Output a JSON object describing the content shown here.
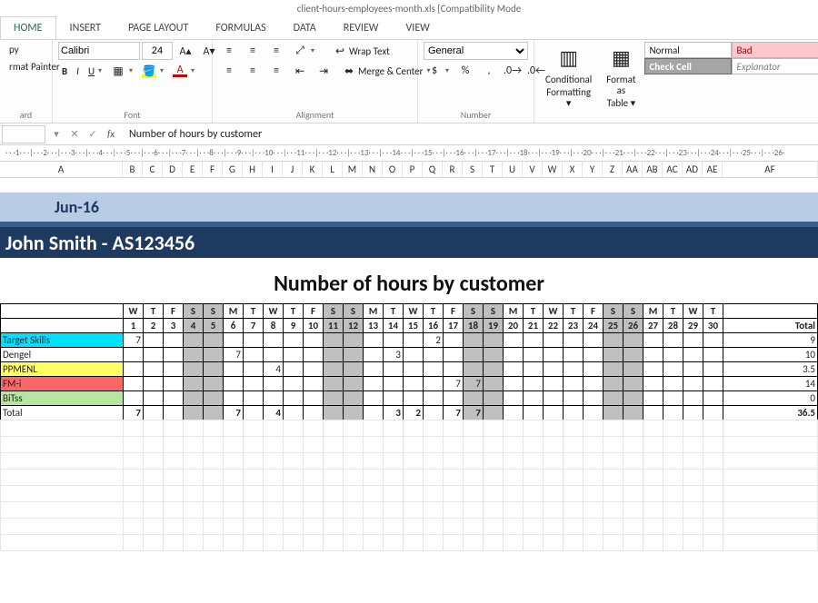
{
  "window": {
    "title": "client-hours-employees-month.xls  [Compatibility Mode"
  },
  "tabs": [
    "HOME",
    "INSERT",
    "PAGE LAYOUT",
    "FORMULAS",
    "DATA",
    "REVIEW",
    "VIEW"
  ],
  "tabs_active": 0,
  "clipboard": {
    "copy": "py",
    "format_painter": "rmat Painter",
    "group": "ard"
  },
  "font": {
    "name": "Calibri",
    "size": "24",
    "bold": "B",
    "italic": "I",
    "underline": "U",
    "group": "Font"
  },
  "alignment": {
    "wrap": "Wrap Text",
    "merge": "Merge & Center",
    "group": "Alignment"
  },
  "number": {
    "format": "General",
    "group": "Number"
  },
  "styles": {
    "cond": "Conditional",
    "cond2": "Formatting ▾",
    "fat": "Format as",
    "fat2": "Table ▾",
    "normal": "Normal",
    "bad": "Bad",
    "check": "Check Cell",
    "expl": "Explanator"
  },
  "formula_bar": {
    "value": "Number of hours by customer"
  },
  "ruler_text": "· · ·1· · ·|· · ·2· · ·|· · ·3· · ·|· · ·4· · ·|· · ·5· · ·|· · ·6· · ·|· · ·7· · ·|· · ·8· · ·|· · ·9· · ·|· · ·10· · ·|· · ·11· · ·|· · ·12· · ·|· · ·13· · ·|· · ·14· · ·|· · ·15· · ·|· · ·16· · ·|· · ·17· · ·|· · ·18· · ·|· · ·19· · ·|· · ·20· · ·|· · ·21· · ·|· · ·22· · ·|· · ·23· · ·|· · ·24· · ·|· · ·25· · ·|· · ·26·",
  "col_letters": [
    "A",
    "B",
    "C",
    "D",
    "E",
    "F",
    "G",
    "H",
    "I",
    "J",
    "K",
    "L",
    "M",
    "N",
    "O",
    "P",
    "Q",
    "R",
    "S",
    "T",
    "U",
    "V",
    "W",
    "X",
    "Y",
    "Z",
    "AA",
    "AB",
    "AC",
    "AD",
    "AE",
    "AF"
  ],
  "doc": {
    "month": "Jun-16",
    "person": "John Smith -  AS123456",
    "title": "Number of hours by customer",
    "days_wd": [
      "W",
      "T",
      "F",
      "S",
      "S",
      "M",
      "T",
      "W",
      "T",
      "F",
      "S",
      "S",
      "M",
      "T",
      "W",
      "T",
      "F",
      "S",
      "S",
      "M",
      "T",
      "W",
      "T",
      "F",
      "S",
      "S",
      "M",
      "T",
      "W",
      "T"
    ],
    "days_num": [
      "1",
      "2",
      "3",
      "4",
      "5",
      "6",
      "7",
      "8",
      "9",
      "10",
      "11",
      "12",
      "13",
      "14",
      "15",
      "16",
      "17",
      "18",
      "19",
      "20",
      "21",
      "22",
      "23",
      "24",
      "25",
      "26",
      "27",
      "28",
      "29",
      "30"
    ],
    "weekend_idx": [
      3,
      4,
      10,
      11,
      17,
      18,
      24,
      25
    ],
    "total_label": "Total",
    "rows": [
      {
        "label": "Target Skills",
        "class": "r-target",
        "cells": [
          "7",
          "",
          "",
          "",
          "",
          "",
          "",
          "",
          "",
          "",
          "",
          "",
          "",
          "",
          "",
          "2",
          "",
          "",
          "",
          "",
          "",
          "",
          "",
          "",
          "",
          "",
          "",
          "",
          "",
          ""
        ],
        "total": "9"
      },
      {
        "label": "Dengel",
        "class": "r-dengel",
        "cells": [
          "",
          "",
          "",
          "",
          "",
          "7",
          "",
          "",
          "",
          "",
          "",
          "",
          "",
          "3",
          "",
          "",
          "",
          "",
          "",
          "",
          "",
          "",
          "",
          "",
          "",
          "",
          "",
          "",
          "",
          ""
        ],
        "total": "10"
      },
      {
        "label": "PPMENL",
        "class": "r-ppmenl",
        "cells": [
          "",
          "",
          "",
          "",
          "",
          "",
          "",
          "4",
          "",
          "",
          "",
          "",
          "",
          "",
          "",
          "",
          "",
          "",
          "",
          "",
          "",
          "",
          "",
          "",
          "",
          "",
          "",
          "",
          "",
          ""
        ],
        "total": "3.5"
      },
      {
        "label": "FM-i",
        "class": "r-fmi",
        "cells": [
          "",
          "",
          "",
          "",
          "",
          "",
          "",
          "",
          "",
          "",
          "",
          "",
          "",
          "",
          "",
          "",
          "7",
          "7",
          "",
          "",
          "",
          "",
          "",
          "",
          "",
          "",
          "",
          "",
          "",
          ""
        ],
        "total": "14"
      },
      {
        "label": "BiTss",
        "class": "r-bitss",
        "cells": [
          "",
          "",
          "",
          "",
          "",
          "",
          "",
          "",
          "",
          "",
          "",
          "",
          "",
          "",
          "",
          "",
          "",
          "",
          "",
          "",
          "",
          "",
          "",
          "",
          "",
          "",
          "",
          "",
          "",
          ""
        ],
        "total": "0"
      },
      {
        "label": "Total",
        "class": "r-total",
        "cells": [
          "7",
          "",
          "",
          "",
          "",
          "7",
          "",
          "4",
          "",
          "",
          "",
          "",
          "",
          "3",
          "2",
          "",
          "7",
          "7",
          "",
          "",
          "",
          "",
          "",
          "",
          "",
          "",
          "",
          "",
          "",
          ""
        ],
        "total": "36.5"
      }
    ]
  }
}
